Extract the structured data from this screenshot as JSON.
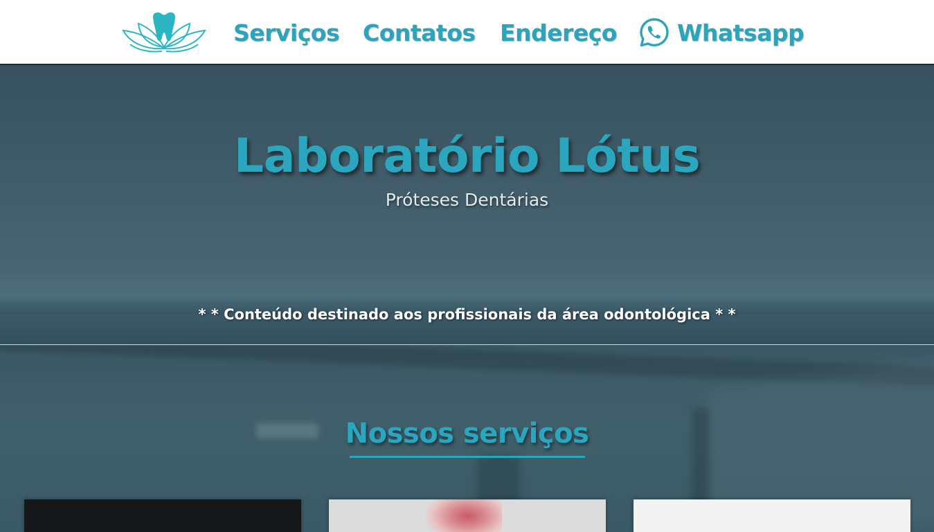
{
  "nav": {
    "logo_icon": "lotus-tooth-icon",
    "items": [
      {
        "label": "Serviços"
      },
      {
        "label": "Contatos"
      },
      {
        "label": "Endereço"
      },
      {
        "label": "Whatsapp",
        "icon": "whatsapp-icon"
      }
    ]
  },
  "hero": {
    "title": "Laboratório Lótus",
    "subtitle": "Próteses Dentárias",
    "disclaimer": "* * Conteúdo destinado aos profissionais da área odontológica * *"
  },
  "services": {
    "title": "Nossos serviços"
  },
  "colors": {
    "accent": "#2ba6bf",
    "hero_bg": "#405c69",
    "nav_bg": "#ffffff"
  }
}
